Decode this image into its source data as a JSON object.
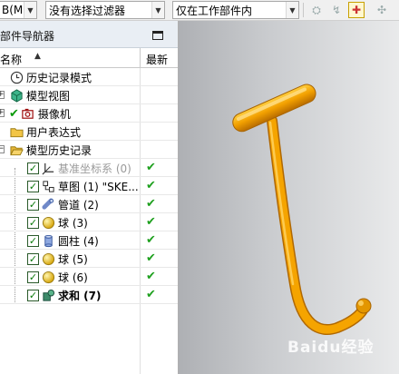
{
  "toolbar": {
    "menu_label": "B(M)",
    "filter_dropdown": "没有选择过滤器",
    "scope_dropdown": "仅在工作部件内"
  },
  "navigator": {
    "title": "部件导航器",
    "col_name": "名称",
    "col_latest": "最新",
    "items": [
      {
        "label": "历史记录模式",
        "latest": ""
      },
      {
        "label": "模型视图",
        "latest": ""
      },
      {
        "label": "摄像机",
        "latest": ""
      },
      {
        "label": "用户表达式",
        "latest": ""
      },
      {
        "label": "模型历史记录",
        "latest": ""
      },
      {
        "label": "基准坐标系 (0)",
        "latest": "✔"
      },
      {
        "label": "草图 (1) \"SKE...",
        "latest": "✔"
      },
      {
        "label": "管道 (2)",
        "latest": "✔"
      },
      {
        "label": "球 (3)",
        "latest": "✔"
      },
      {
        "label": "圆柱 (4)",
        "latest": "✔"
      },
      {
        "label": "球 (5)",
        "latest": "✔"
      },
      {
        "label": "球 (6)",
        "latest": "✔"
      },
      {
        "label": "求和 (7)",
        "latest": "✔"
      }
    ]
  },
  "viewport": {
    "model_color": "#f5a400",
    "watermark": "Baidu经验"
  },
  "colors": {
    "check_green": "#1ea01e",
    "model_orange": "#f5a400"
  }
}
